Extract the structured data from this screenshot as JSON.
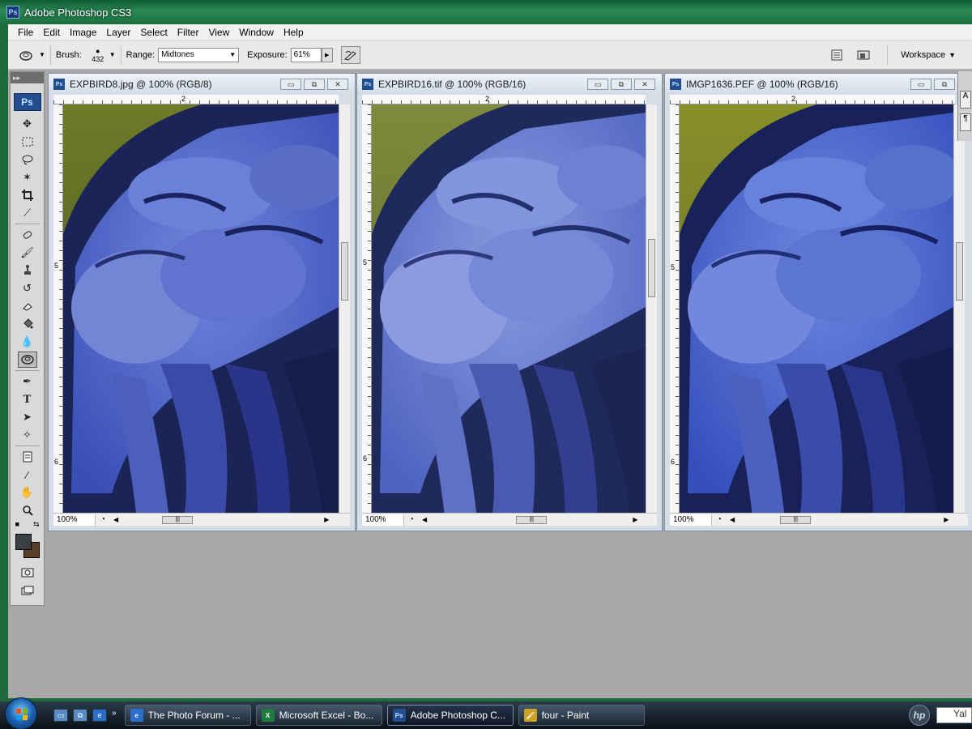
{
  "app": {
    "title": "Adobe Photoshop CS3",
    "badge": "Ps"
  },
  "menu": [
    "File",
    "Edit",
    "Image",
    "Layer",
    "Select",
    "Filter",
    "View",
    "Window",
    "Help"
  ],
  "options": {
    "brush_label": "Brush:",
    "brush_size": "432",
    "range_label": "Range:",
    "range_value": "Midtones",
    "exposure_label": "Exposure:",
    "exposure_value": "61%",
    "workspace_label": "Workspace"
  },
  "toolbox": {
    "logo": "Ps",
    "foreground": "#3a4048",
    "background": "#5d3f25"
  },
  "documents": [
    {
      "title": "EXPBIRD8.jpg @ 100% (RGB/8)",
      "zoom": "100%",
      "ruler_h": "2",
      "ruler_v": [
        "5",
        "6"
      ]
    },
    {
      "title": "EXPBIRD16.tif @ 100% (RGB/16)",
      "zoom": "100%",
      "ruler_h": "2",
      "ruler_v": [
        "5",
        "6"
      ]
    },
    {
      "title": "IMGP1636.PEF @ 100% (RGB/16)",
      "zoom": "100%",
      "ruler_h": "2",
      "ruler_v": [
        "5",
        "6"
      ]
    }
  ],
  "window_buttons": {
    "minimize": "▭",
    "restore": "⧉",
    "close": "✕"
  },
  "taskbar": {
    "items": [
      {
        "label": "The Photo Forum - ...",
        "icon": "ie-icon"
      },
      {
        "label": "Microsoft Excel - Bo...",
        "icon": "excel-icon"
      },
      {
        "label": "Adobe Photoshop C...",
        "icon": "photoshop-icon",
        "active": true
      },
      {
        "label": "four - Paint",
        "icon": "paint-icon"
      }
    ],
    "search_text": "Yal",
    "hp_logo": "hp"
  }
}
